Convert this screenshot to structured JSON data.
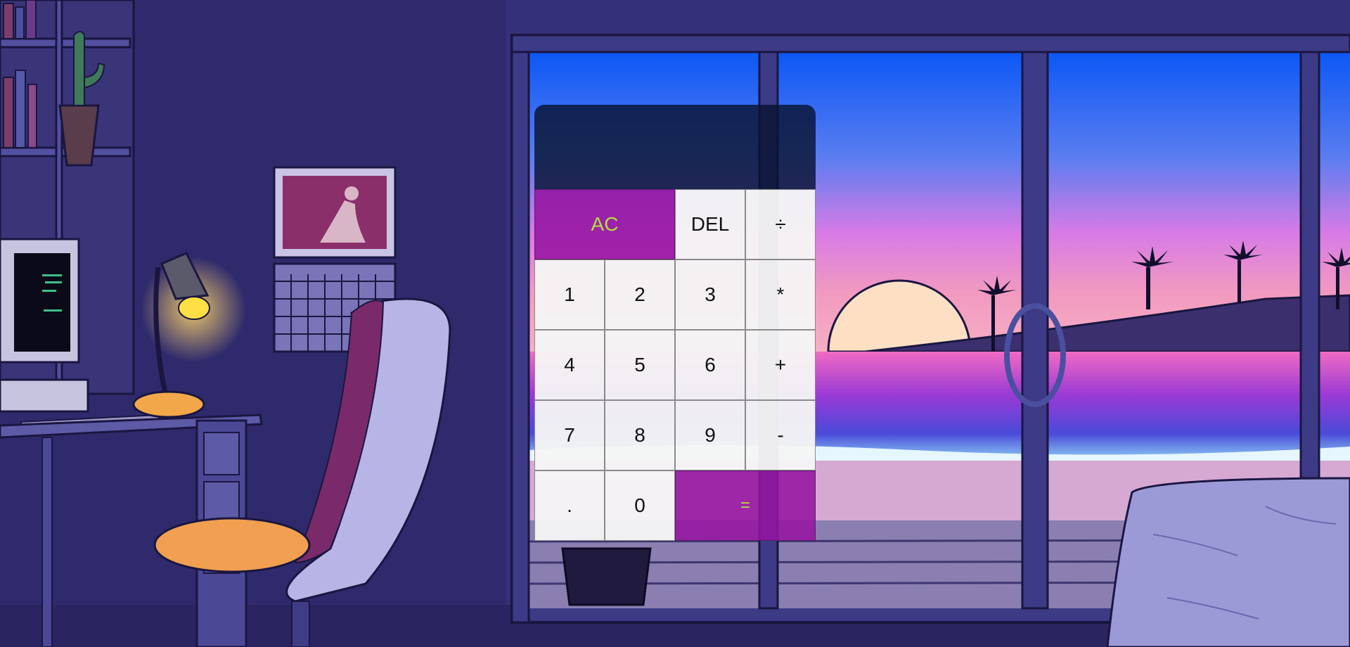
{
  "colors": {
    "display_bg": "#081432",
    "key_bg": "#f3f3f3",
    "key_text": "#111111",
    "accent_bg": "#9614a0",
    "accent_text": "#b4e03a"
  },
  "display": {
    "previous_operand": "",
    "current_operand": ""
  },
  "keys": {
    "all_clear": "AC",
    "delete": "DEL",
    "divide": "÷",
    "one": "1",
    "two": "2",
    "three": "3",
    "multiply": "*",
    "four": "4",
    "five": "5",
    "six": "6",
    "add": "+",
    "seven": "7",
    "eight": "8",
    "nine": "9",
    "subtract": "-",
    "decimal": ".",
    "zero": "0",
    "equals": "="
  }
}
